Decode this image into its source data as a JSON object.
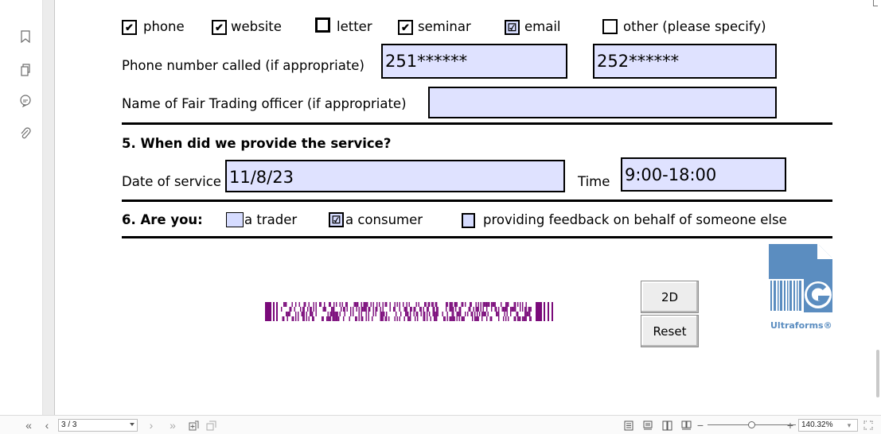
{
  "contact_methods": [
    {
      "label": "phone",
      "checked": true
    },
    {
      "label": "website",
      "checked": true
    },
    {
      "label": "letter",
      "checked": false
    },
    {
      "label": "seminar",
      "checked": true
    },
    {
      "label": "email",
      "checked": true
    },
    {
      "label": "other (please specify)",
      "checked": false
    }
  ],
  "phone_row": {
    "label": "Phone number called (if appropriate)",
    "value1": "251******",
    "value2": "252******"
  },
  "officer_row": {
    "label": "Name of Fair Trading officer (if appropriate)",
    "value": ""
  },
  "section5": {
    "heading": "5.  When did we provide the service?",
    "date_label": "Date of service",
    "date_value": "11/8/23",
    "time_label": "Time",
    "time_value": "9:00-18:00"
  },
  "section6": {
    "heading": "6.  Are you:",
    "options": [
      {
        "label": "a trader",
        "checked": false
      },
      {
        "label": "a consumer",
        "checked": true
      },
      {
        "label": "providing feedback on behalf of someone else",
        "checked": false
      }
    ]
  },
  "buttons": {
    "two_d": "2D",
    "reset": "Reset"
  },
  "logo_text": "Ultraforms®",
  "toolbar": {
    "first_page": "«",
    "prev_page": "‹",
    "page_value": "3 / 3",
    "next_page": "›",
    "last_page": "»",
    "zoom_minus": "−",
    "zoom_plus": "+",
    "zoom_value": "140.32%"
  },
  "colors": {
    "field_fill": "#dfe2ff",
    "checkbox_fill": "#d6dcff",
    "barcode": "#7a0a7a",
    "logo_blue": "#5b8dc0"
  }
}
